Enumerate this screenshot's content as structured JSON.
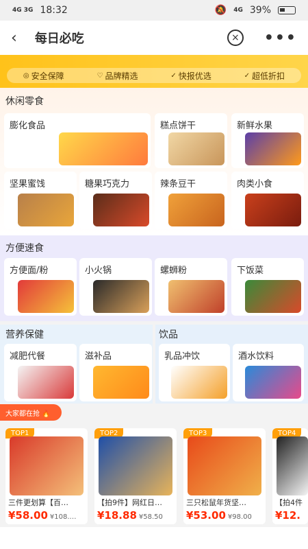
{
  "status_bar": {
    "left": "4G 3G",
    "time": "18:32",
    "battery": "39%",
    "battery_level": 0.39
  },
  "nav": {
    "title": "每日必吃"
  },
  "pills": [
    {
      "label": "安全保障"
    },
    {
      "label": "品牌精选"
    },
    {
      "label": "快报优选"
    },
    {
      "label": "超低折扣"
    }
  ],
  "sections": {
    "snacks": {
      "title": "休闲零食",
      "items": [
        "膨化食品",
        "糕点饼干",
        "新鲜水果",
        "坚果蜜饯",
        "糖果巧克力",
        "辣条豆干",
        "肉类小食"
      ]
    },
    "instant": {
      "title": "方便速食",
      "items": [
        "方便面/粉",
        "小火锅",
        "螺蛳粉",
        "下饭菜"
      ]
    },
    "health": {
      "title": "营养保健",
      "items": [
        "减肥代餐",
        "滋补品"
      ]
    },
    "drinks": {
      "title": "饮品",
      "items": [
        "乳品冲饮",
        "酒水饮料"
      ]
    }
  },
  "promo": {
    "label": "大家都在抢 🔥"
  },
  "products": [
    {
      "badge": "TOP1",
      "name": "三件更划算【百…",
      "price": "¥58.00",
      "orig": "¥108.…"
    },
    {
      "badge": "TOP2",
      "name": "【拍9件】网红日…",
      "price": "¥18.88",
      "orig": "¥58.50"
    },
    {
      "badge": "TOP3",
      "name": "三只松鼠年货坚…",
      "price": "¥53.00",
      "orig": "¥98.00"
    },
    {
      "badge": "TOP4",
      "name": "【拍4件",
      "price": "¥12.",
      "orig": ""
    }
  ],
  "colors": {
    "accent": "#ff2a00",
    "banner": "#ffc21a"
  }
}
